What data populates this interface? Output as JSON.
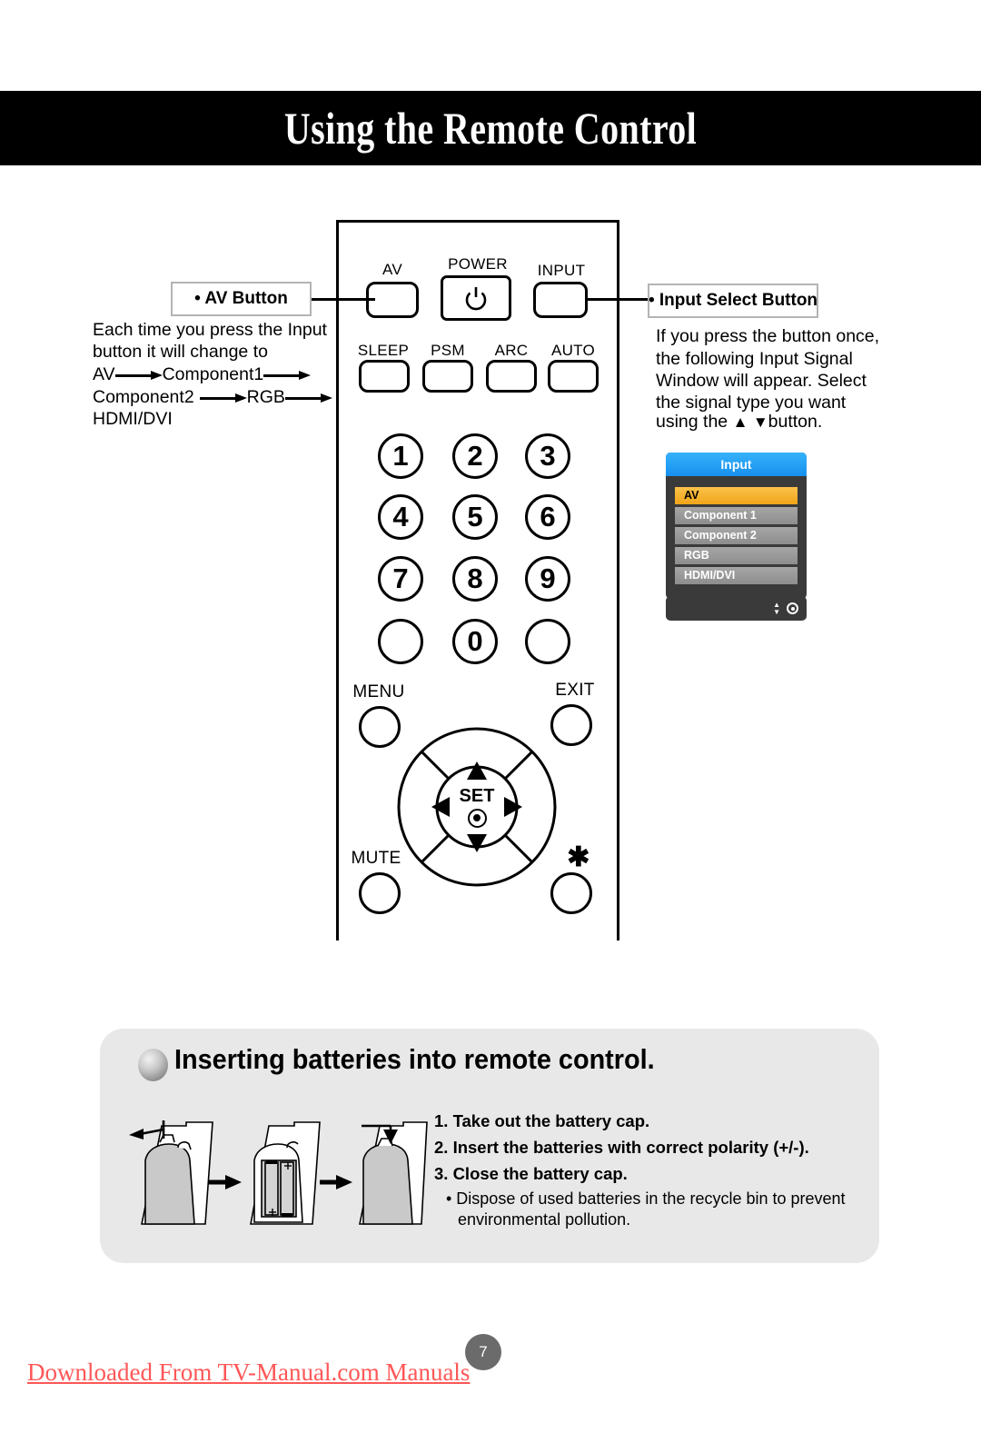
{
  "header": {
    "title": "Using the Remote Control"
  },
  "av_callout": {
    "title": "• AV Button",
    "line1": "Each time you press the Input",
    "line2": "button it will change to",
    "flow_row1_a": "AV",
    "flow_row1_b": "Component1",
    "flow_row2_a": "Component2",
    "flow_row2_b": "RGB",
    "flow_row3": "HDMI/DVI"
  },
  "input_callout": {
    "title": "• Input Select Button",
    "line1": "If you press the button once,",
    "line2": "the following Input Signal",
    "line3": "Window will appear. Select",
    "line4": "the signal type you want",
    "line5_pre": "using the",
    "line5_up": "▲",
    "line5_down": "▼",
    "line5_post": "button."
  },
  "osd": {
    "title": "Input",
    "items": [
      {
        "label": "AV",
        "selected": true
      },
      {
        "label": "Component 1",
        "selected": false
      },
      {
        "label": "Component 2",
        "selected": false
      },
      {
        "label": "RGB",
        "selected": false
      },
      {
        "label": "HDMI/DVI",
        "selected": false
      }
    ],
    "title_bar_color": "#1790ee",
    "selected_color": "#f0a519",
    "body_color": "#3a3a3a"
  },
  "remote": {
    "top_row": [
      {
        "label": "AV"
      },
      {
        "label": "POWER"
      },
      {
        "label": "INPUT"
      }
    ],
    "second_row": [
      {
        "label": "SLEEP"
      },
      {
        "label": "PSM"
      },
      {
        "label": "ARC"
      },
      {
        "label": "AUTO"
      }
    ],
    "keypad": [
      "1",
      "2",
      "3",
      "4",
      "5",
      "6",
      "7",
      "8",
      "9",
      "",
      "0",
      ""
    ],
    "menu_label": "MENU",
    "exit_label": "EXIT",
    "mute_label": "MUTE",
    "star_label": "✱",
    "set_label": "SET",
    "nav_up": "▲",
    "nav_down": "▼",
    "nav_left": "◀",
    "nav_right": "▶"
  },
  "battery": {
    "heading": "Inserting batteries into remote control.",
    "steps": [
      "1. Take out the battery cap.",
      "2. Insert the batteries with correct polarity (+/-).",
      "3. Close the battery cap."
    ],
    "note_line1": "• Dispose of used batteries in the recycle bin to prevent",
    "note_line2": "environmental pollution."
  },
  "footer": {
    "page_number": "7",
    "watermark": "Downloaded From TV-Manual.com Manuals"
  }
}
